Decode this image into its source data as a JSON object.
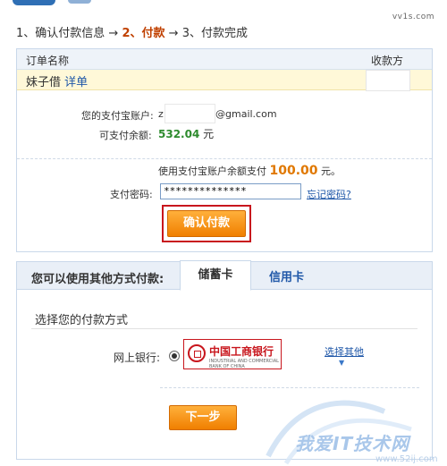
{
  "site_mark": "vv1s.com",
  "steps": {
    "step1": "1、确认付款信息",
    "arrow1": "→",
    "step2": "2、付款",
    "arrow2": "→",
    "step3": "3、付款完成"
  },
  "order": {
    "col_name": "订单名称",
    "col_payee": "收款方",
    "item_name": "妹子借",
    "detail_link": "详单"
  },
  "account": {
    "label": "您的支付宝账户:",
    "prefix": "z",
    "suffix": "@gmail.com",
    "balance_label": "可支付余额:",
    "balance_value": "532.04",
    "balance_unit": "元"
  },
  "payment": {
    "desc_prefix": "使用支付宝账户余额支付",
    "amount": "100.00",
    "unit": "元。",
    "password_label": "支付密码:",
    "password_value": "**************",
    "forgot_link": "忘记密码?",
    "confirm_button": "确认付款"
  },
  "alt": {
    "title": "您可以使用其他方式付款:",
    "tabs": [
      "储蓄卡",
      "信用卡"
    ],
    "choose_title": "选择您的付款方式",
    "bank_label": "网上银行:",
    "bank_name": "中国工商银行",
    "bank_name_en": "INDUSTRIAL AND COMMERCIAL BANK OF CHINA",
    "choose_other": "选择其他",
    "next_button": "下一步"
  },
  "watermark": {
    "text": "我爱IT技术网",
    "url": "www.52ij.com"
  },
  "colors": {
    "accent_orange": "#f07f00",
    "amount_orange": "#e07800",
    "link_blue": "#1f57a8",
    "balance_green": "#2e8b2e",
    "highlight_red": "#c8161d"
  }
}
